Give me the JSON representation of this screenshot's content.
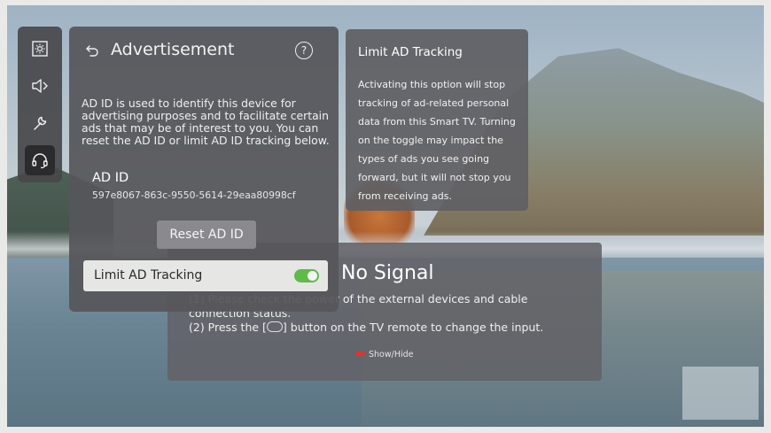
{
  "advertisement_panel": {
    "title": "Advertisement",
    "help_symbol": "?",
    "description": "AD ID is used to identify this device for advertising purposes and to facilitate certain ads that may be of interest to you. You can reset the AD ID or limit AD ID tracking below.",
    "ad_id_label": "AD ID",
    "ad_id_value": "597e8067-863c-9550-5614-29eaa80998cf",
    "reset_button_label": "Reset AD ID",
    "limit_tracking_label": "Limit AD Tracking",
    "limit_tracking_enabled": true
  },
  "sidebar": {
    "items": [
      {
        "icon": "picture-settings-icon"
      },
      {
        "icon": "sound-icon"
      },
      {
        "icon": "wrench-icon"
      },
      {
        "icon": "headset-support-icon",
        "active": true
      }
    ]
  },
  "tooltip": {
    "title": "Limit AD Tracking",
    "body": "Activating this option will stop tracking of ad-related personal data from this Smart TV. Turning on the toggle may impact the types of ads you see going forward, but it will not stop you from receiving ads."
  },
  "no_signal": {
    "title": "No Signal",
    "line1": "(1) Please check the power of the external devices and cable connection status.",
    "line2_prefix": "(2) Press the [",
    "line2_suffix": "] button on the TV remote to change the input.",
    "show_hide_label": "Show/Hide"
  },
  "colors": {
    "toggle_on": "#5fba4a",
    "red_key": "#e0342e"
  }
}
